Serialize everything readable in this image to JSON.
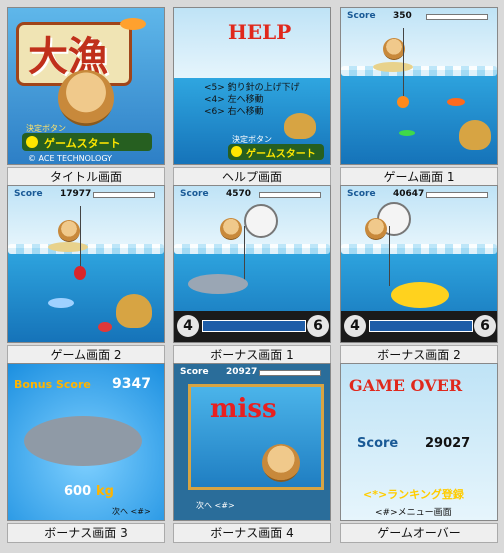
{
  "captions": [
    "タイトル画面",
    "ヘルプ画面",
    "ゲーム画面 1",
    "ゲーム画面 2",
    "ボーナス画面 1",
    "ボーナス画面 2",
    "ボーナス画面 3",
    "ボーナス画面 4",
    "ゲームオーバー"
  ],
  "title_screen": {
    "logo": "大漁",
    "start_small": "決定ボタン",
    "start": "ゲームスタート",
    "copyright": "© ACE TECHNOLOGY"
  },
  "help_screen": {
    "heading": "HELP",
    "lines": [
      "<5> 釣り針の上げ下げ",
      "<4> 左へ移動",
      "<6> 右へ移動"
    ],
    "start_small": "決定ボタン",
    "start": "ゲームスタート"
  },
  "game1": {
    "score_label": "Score",
    "score": "350"
  },
  "game2": {
    "score_label": "Score",
    "score": "17977"
  },
  "bonus1": {
    "score_label": "Score",
    "score": "4570",
    "left_key": "4",
    "right_key": "6"
  },
  "bonus2": {
    "score_label": "Score",
    "score": "40647",
    "left_key": "4",
    "right_key": "6"
  },
  "bonus3": {
    "label": "Bonus Score",
    "score": "9347",
    "weight": "600",
    "unit": "kg",
    "next": "次へ <#>"
  },
  "bonus4": {
    "score_label": "Score",
    "score": "20927",
    "miss": "miss",
    "next": "次へ <#>"
  },
  "gameover": {
    "heading": "GAME OVER",
    "score_label": "Score",
    "score": "29027",
    "ranking": "<*>ランキング登録",
    "menu": "<#>メニュー画面"
  },
  "colors": {
    "sky": "#bfe3f6",
    "sea": "#1572b8",
    "title_bg": "#2d7fc6",
    "bonus_bg": "#1b8fe0",
    "gold": "#ffb400"
  }
}
